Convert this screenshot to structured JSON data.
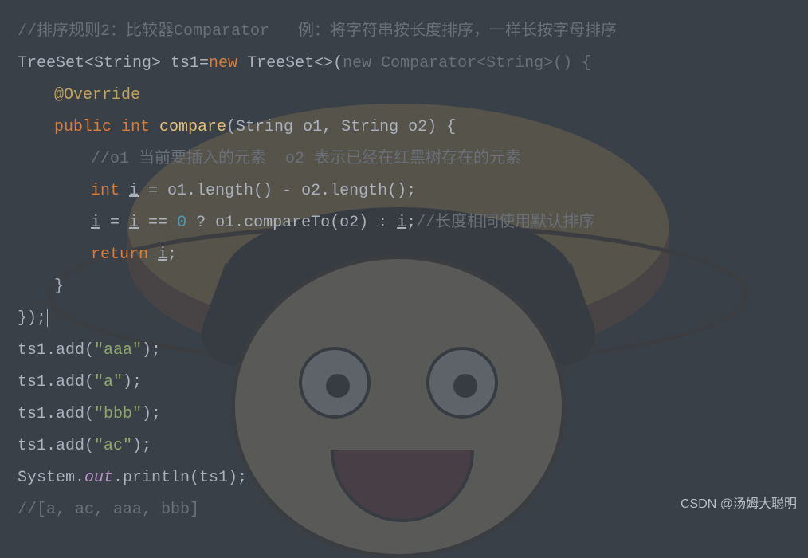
{
  "code": {
    "l1": "//排序规则2：比较器Comparator   例：将字符串按长度排序，一样长按字母排序",
    "l2a": "TreeSet<String> ts1=",
    "l2b": "new",
    "l2c": " TreeSet<>(",
    "l2d": "new",
    "l2e": " Comparator<String>() {",
    "l3": "@Override",
    "l4a": "public",
    "l4b": " int",
    "l4c": " compare",
    "l4d": "(String o1, String o2) {",
    "l5": "//o1 当前要插入的元素  o2 表示已经在红黑树存在的元素",
    "l6a": "int ",
    "l6b": "i",
    "l6c": " = o1.length() - o2.length();",
    "l7a": "i",
    "l7b": " = ",
    "l7c": "i",
    "l7d": " == ",
    "l7e": "0",
    "l7f": " ? o1.compareTo(o2) : ",
    "l7g": "i",
    "l7h": ";",
    "l7i": "//长度相同使用默认排序",
    "l8a": "return ",
    "l8b": "i",
    "l8c": ";",
    "l9": "}",
    "l10": "});",
    "l11a": "ts1.add(",
    "l11b": "\"aaa\"",
    "l11c": ");",
    "l12a": "ts1.add(",
    "l12b": "\"a\"",
    "l12c": ");",
    "l13a": "ts1.add(",
    "l13b": "\"bbb\"",
    "l13c": ");",
    "l14a": "ts1.add(",
    "l14b": "\"ac\"",
    "l14c": ");",
    "l15a": "System.",
    "l15b": "out",
    "l15c": ".println(ts1);",
    "l16": "//[a, ac, aaa, bbb]"
  },
  "watermark": "CSDN @汤姆大聪明"
}
